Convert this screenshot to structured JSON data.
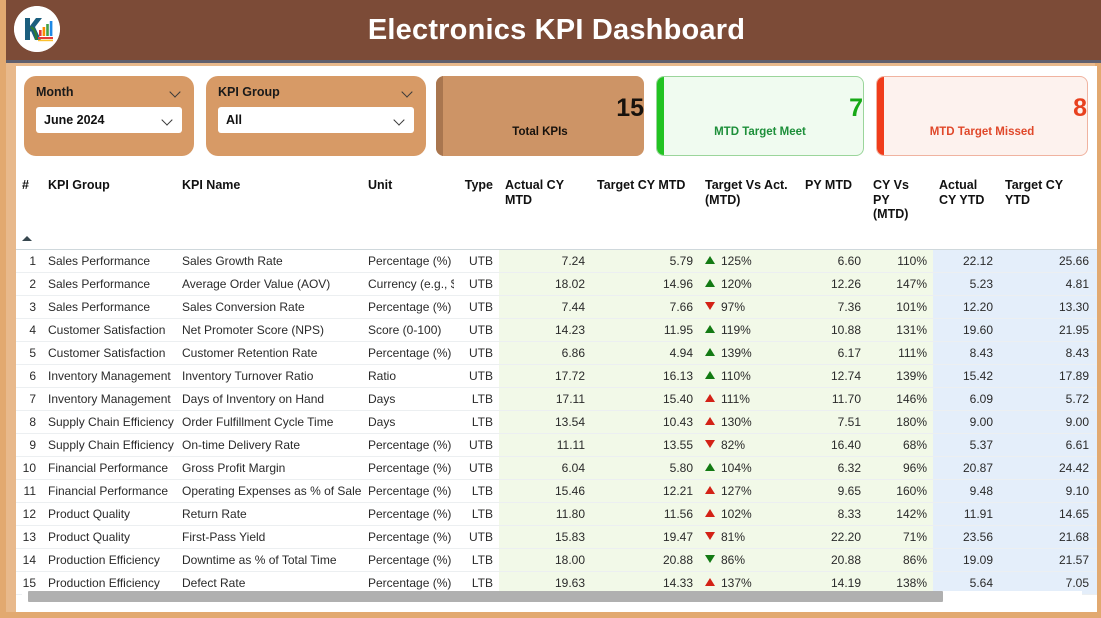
{
  "header": {
    "title": "Electronics KPI Dashboard",
    "logo_icon": "rk-analytics-logo-icon",
    "bg_color": "#7c4b37"
  },
  "filters": {
    "month": {
      "label": "Month",
      "value": "June 2024",
      "chevron_icon": "chevron-down-icon"
    },
    "kpi_group": {
      "label": "KPI Group",
      "value": "All",
      "chevron_icon": "chevron-down-icon"
    }
  },
  "cards": {
    "total": {
      "value": "15",
      "label": "Total KPIs",
      "accent": "#a9764f"
    },
    "meet": {
      "value": "7",
      "label": "MTD Target Meet",
      "accent": "#22c322"
    },
    "missed": {
      "value": "8",
      "label": "MTD Target Missed",
      "accent": "#f03c1b"
    }
  },
  "table": {
    "columns": [
      "#",
      "KPI Group",
      "KPI Name",
      "Unit",
      "Type",
      "Actual CY MTD",
      "Target CY MTD",
      "Target Vs Act. (MTD)",
      "PY MTD",
      "CY Vs PY (MTD)",
      "Actual CY YTD",
      "Target CY YTD"
    ],
    "sort_icon": "sort-ascending-icon",
    "rows": [
      {
        "n": "1",
        "group": "Sales Performance",
        "name": "Sales Growth Rate",
        "unit": "Percentage (%)",
        "type": "UTB",
        "actual_mtd": "7.24",
        "target_mtd": "5.79",
        "tva": "125%",
        "tva_dir": "up",
        "tva_color": "g",
        "py_mtd": "6.60",
        "cy_vs_py": "110%",
        "actual_ytd": "22.12",
        "target_ytd": "25.66"
      },
      {
        "n": "2",
        "group": "Sales Performance",
        "name": "Average Order Value (AOV)",
        "unit": "Currency (e.g., $)",
        "type": "UTB",
        "actual_mtd": "18.02",
        "target_mtd": "14.96",
        "tva": "120%",
        "tva_dir": "up",
        "tva_color": "g",
        "py_mtd": "12.26",
        "cy_vs_py": "147%",
        "actual_ytd": "5.23",
        "target_ytd": "4.81"
      },
      {
        "n": "3",
        "group": "Sales Performance",
        "name": "Sales Conversion Rate",
        "unit": "Percentage (%)",
        "type": "UTB",
        "actual_mtd": "7.44",
        "target_mtd": "7.66",
        "tva": "97%",
        "tva_dir": "down",
        "tva_color": "r",
        "py_mtd": "7.36",
        "cy_vs_py": "101%",
        "actual_ytd": "12.20",
        "target_ytd": "13.30"
      },
      {
        "n": "4",
        "group": "Customer Satisfaction",
        "name": "Net Promoter Score (NPS)",
        "unit": "Score (0-100)",
        "type": "UTB",
        "actual_mtd": "14.23",
        "target_mtd": "11.95",
        "tva": "119%",
        "tva_dir": "up",
        "tva_color": "g",
        "py_mtd": "10.88",
        "cy_vs_py": "131%",
        "actual_ytd": "19.60",
        "target_ytd": "21.95"
      },
      {
        "n": "5",
        "group": "Customer Satisfaction",
        "name": "Customer Retention Rate",
        "unit": "Percentage (%)",
        "type": "UTB",
        "actual_mtd": "6.86",
        "target_mtd": "4.94",
        "tva": "139%",
        "tva_dir": "up",
        "tva_color": "g",
        "py_mtd": "6.17",
        "cy_vs_py": "111%",
        "actual_ytd": "8.43",
        "target_ytd": "8.43"
      },
      {
        "n": "6",
        "group": "Inventory Management",
        "name": "Inventory Turnover Ratio",
        "unit": "Ratio",
        "type": "UTB",
        "actual_mtd": "17.72",
        "target_mtd": "16.13",
        "tva": "110%",
        "tva_dir": "up",
        "tva_color": "g",
        "py_mtd": "12.74",
        "cy_vs_py": "139%",
        "actual_ytd": "15.42",
        "target_ytd": "17.89"
      },
      {
        "n": "7",
        "group": "Inventory Management",
        "name": "Days of Inventory on Hand",
        "unit": "Days",
        "type": "LTB",
        "actual_mtd": "17.11",
        "target_mtd": "15.40",
        "tva": "111%",
        "tva_dir": "up",
        "tva_color": "r",
        "py_mtd": "11.70",
        "cy_vs_py": "146%",
        "actual_ytd": "6.09",
        "target_ytd": "5.72"
      },
      {
        "n": "8",
        "group": "Supply Chain Efficiency",
        "name": "Order Fulfillment Cycle Time",
        "unit": "Days",
        "type": "LTB",
        "actual_mtd": "13.54",
        "target_mtd": "10.43",
        "tva": "130%",
        "tva_dir": "up",
        "tva_color": "r",
        "py_mtd": "7.51",
        "cy_vs_py": "180%",
        "actual_ytd": "9.00",
        "target_ytd": "9.00"
      },
      {
        "n": "9",
        "group": "Supply Chain Efficiency",
        "name": "On-time Delivery Rate",
        "unit": "Percentage (%)",
        "type": "UTB",
        "actual_mtd": "11.11",
        "target_mtd": "13.55",
        "tva": "82%",
        "tva_dir": "down",
        "tva_color": "r",
        "py_mtd": "16.40",
        "cy_vs_py": "68%",
        "actual_ytd": "5.37",
        "target_ytd": "6.61"
      },
      {
        "n": "10",
        "group": "Financial Performance",
        "name": "Gross Profit Margin",
        "unit": "Percentage (%)",
        "type": "UTB",
        "actual_mtd": "6.04",
        "target_mtd": "5.80",
        "tva": "104%",
        "tva_dir": "up",
        "tva_color": "g",
        "py_mtd": "6.32",
        "cy_vs_py": "96%",
        "actual_ytd": "20.87",
        "target_ytd": "24.42"
      },
      {
        "n": "11",
        "group": "Financial Performance",
        "name": "Operating Expenses as % of Sales",
        "unit": "Percentage (%)",
        "type": "LTB",
        "actual_mtd": "15.46",
        "target_mtd": "12.21",
        "tva": "127%",
        "tva_dir": "up",
        "tva_color": "r",
        "py_mtd": "9.65",
        "cy_vs_py": "160%",
        "actual_ytd": "9.48",
        "target_ytd": "9.10"
      },
      {
        "n": "12",
        "group": "Product Quality",
        "name": "Return Rate",
        "unit": "Percentage (%)",
        "type": "LTB",
        "actual_mtd": "11.80",
        "target_mtd": "11.56",
        "tva": "102%",
        "tva_dir": "up",
        "tva_color": "r",
        "py_mtd": "8.33",
        "cy_vs_py": "142%",
        "actual_ytd": "11.91",
        "target_ytd": "14.65"
      },
      {
        "n": "13",
        "group": "Product Quality",
        "name": "First-Pass Yield",
        "unit": "Percentage (%)",
        "type": "UTB",
        "actual_mtd": "15.83",
        "target_mtd": "19.47",
        "tva": "81%",
        "tva_dir": "down",
        "tva_color": "r",
        "py_mtd": "22.20",
        "cy_vs_py": "71%",
        "actual_ytd": "23.56",
        "target_ytd": "21.68"
      },
      {
        "n": "14",
        "group": "Production Efficiency",
        "name": "Downtime as % of Total Time",
        "unit": "Percentage (%)",
        "type": "LTB",
        "actual_mtd": "18.00",
        "target_mtd": "20.88",
        "tva": "86%",
        "tva_dir": "down",
        "tva_color": "g",
        "py_mtd": "20.88",
        "cy_vs_py": "86%",
        "actual_ytd": "19.09",
        "target_ytd": "21.57"
      },
      {
        "n": "15",
        "group": "Production Efficiency",
        "name": "Defect Rate",
        "unit": "Percentage (%)",
        "type": "LTB",
        "actual_mtd": "19.63",
        "target_mtd": "14.33",
        "tva": "137%",
        "tva_dir": "up",
        "tva_color": "r",
        "py_mtd": "14.19",
        "cy_vs_py": "138%",
        "actual_ytd": "5.64",
        "target_ytd": "7.05"
      }
    ]
  },
  "scrollbar": {
    "orientation": "horizontal"
  }
}
